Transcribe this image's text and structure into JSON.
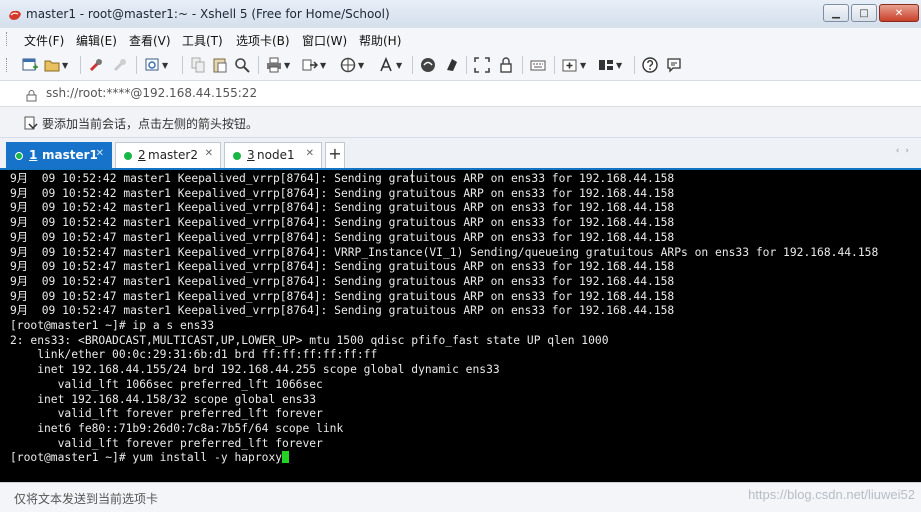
{
  "window": {
    "title": "master1 - root@master1:~ - Xshell 5 (Free for Home/School)"
  },
  "menu": [
    {
      "label": "文件(F)"
    },
    {
      "label": "编辑(E)"
    },
    {
      "label": "查看(V)"
    },
    {
      "label": "工具(T)"
    },
    {
      "label": "选项卡(B)"
    },
    {
      "label": "窗口(W)"
    },
    {
      "label": "帮助(H)"
    }
  ],
  "address": {
    "text": "ssh://root:****@192.168.44.155:22"
  },
  "hint": {
    "text": "要添加当前会话，点击左侧的箭头按钮。"
  },
  "tabs": [
    {
      "num": "1",
      "label": "master1",
      "active": true
    },
    {
      "num": "2",
      "label": "master2",
      "active": false
    },
    {
      "num": "3",
      "label": "node1",
      "active": false
    }
  ],
  "terminal": {
    "lines": [
      "9月  09 10:52:42 master1 Keepalived_vrrp[8764]: Sending gratuitous ARP on ens33 for 192.168.44.158",
      "9月  09 10:52:42 master1 Keepalived_vrrp[8764]: Sending gratuitous ARP on ens33 for 192.168.44.158",
      "9月  09 10:52:42 master1 Keepalived_vrrp[8764]: Sending gratuitous ARP on ens33 for 192.168.44.158",
      "9月  09 10:52:42 master1 Keepalived_vrrp[8764]: Sending gratuitous ARP on ens33 for 192.168.44.158",
      "9月  09 10:52:47 master1 Keepalived_vrrp[8764]: Sending gratuitous ARP on ens33 for 192.168.44.158",
      "9月  09 10:52:47 master1 Keepalived_vrrp[8764]: VRRP_Instance(VI_1) Sending/queueing gratuitous ARPs on ens33 for 192.168.44.158",
      "9月  09 10:52:47 master1 Keepalived_vrrp[8764]: Sending gratuitous ARP on ens33 for 192.168.44.158",
      "9月  09 10:52:47 master1 Keepalived_vrrp[8764]: Sending gratuitous ARP on ens33 for 192.168.44.158",
      "9月  09 10:52:47 master1 Keepalived_vrrp[8764]: Sending gratuitous ARP on ens33 for 192.168.44.158",
      "9月  09 10:52:47 master1 Keepalived_vrrp[8764]: Sending gratuitous ARP on ens33 for 192.168.44.158",
      "[root@master1 ~]# ip a s ens33",
      "2: ens33: <BROADCAST,MULTICAST,UP,LOWER_UP> mtu 1500 qdisc pfifo_fast state UP qlen 1000",
      "    link/ether 00:0c:29:31:6b:d1 brd ff:ff:ff:ff:ff:ff",
      "    inet 192.168.44.155/24 brd 192.168.44.255 scope global dynamic ens33",
      "       valid_lft 1066sec preferred_lft 1066sec",
      "    inet 192.168.44.158/32 scope global ens33",
      "       valid_lft forever preferred_lft forever",
      "    inet6 fe80::71b9:26d0:7c8a:7b5f/64 scope link",
      "       valid_lft forever preferred_lft forever"
    ],
    "prompt": "[root@master1 ~]# yum install -y haproxy"
  },
  "sendbar": {
    "text": "仅将文本发送到当前选项卡"
  },
  "watermark": "https://blog.csdn.net/liuwei52",
  "colors": {
    "tab_active": "#1673c9",
    "session_dot": "#18b646",
    "cursor": "#23d223",
    "terminal_bg": "#000000"
  }
}
